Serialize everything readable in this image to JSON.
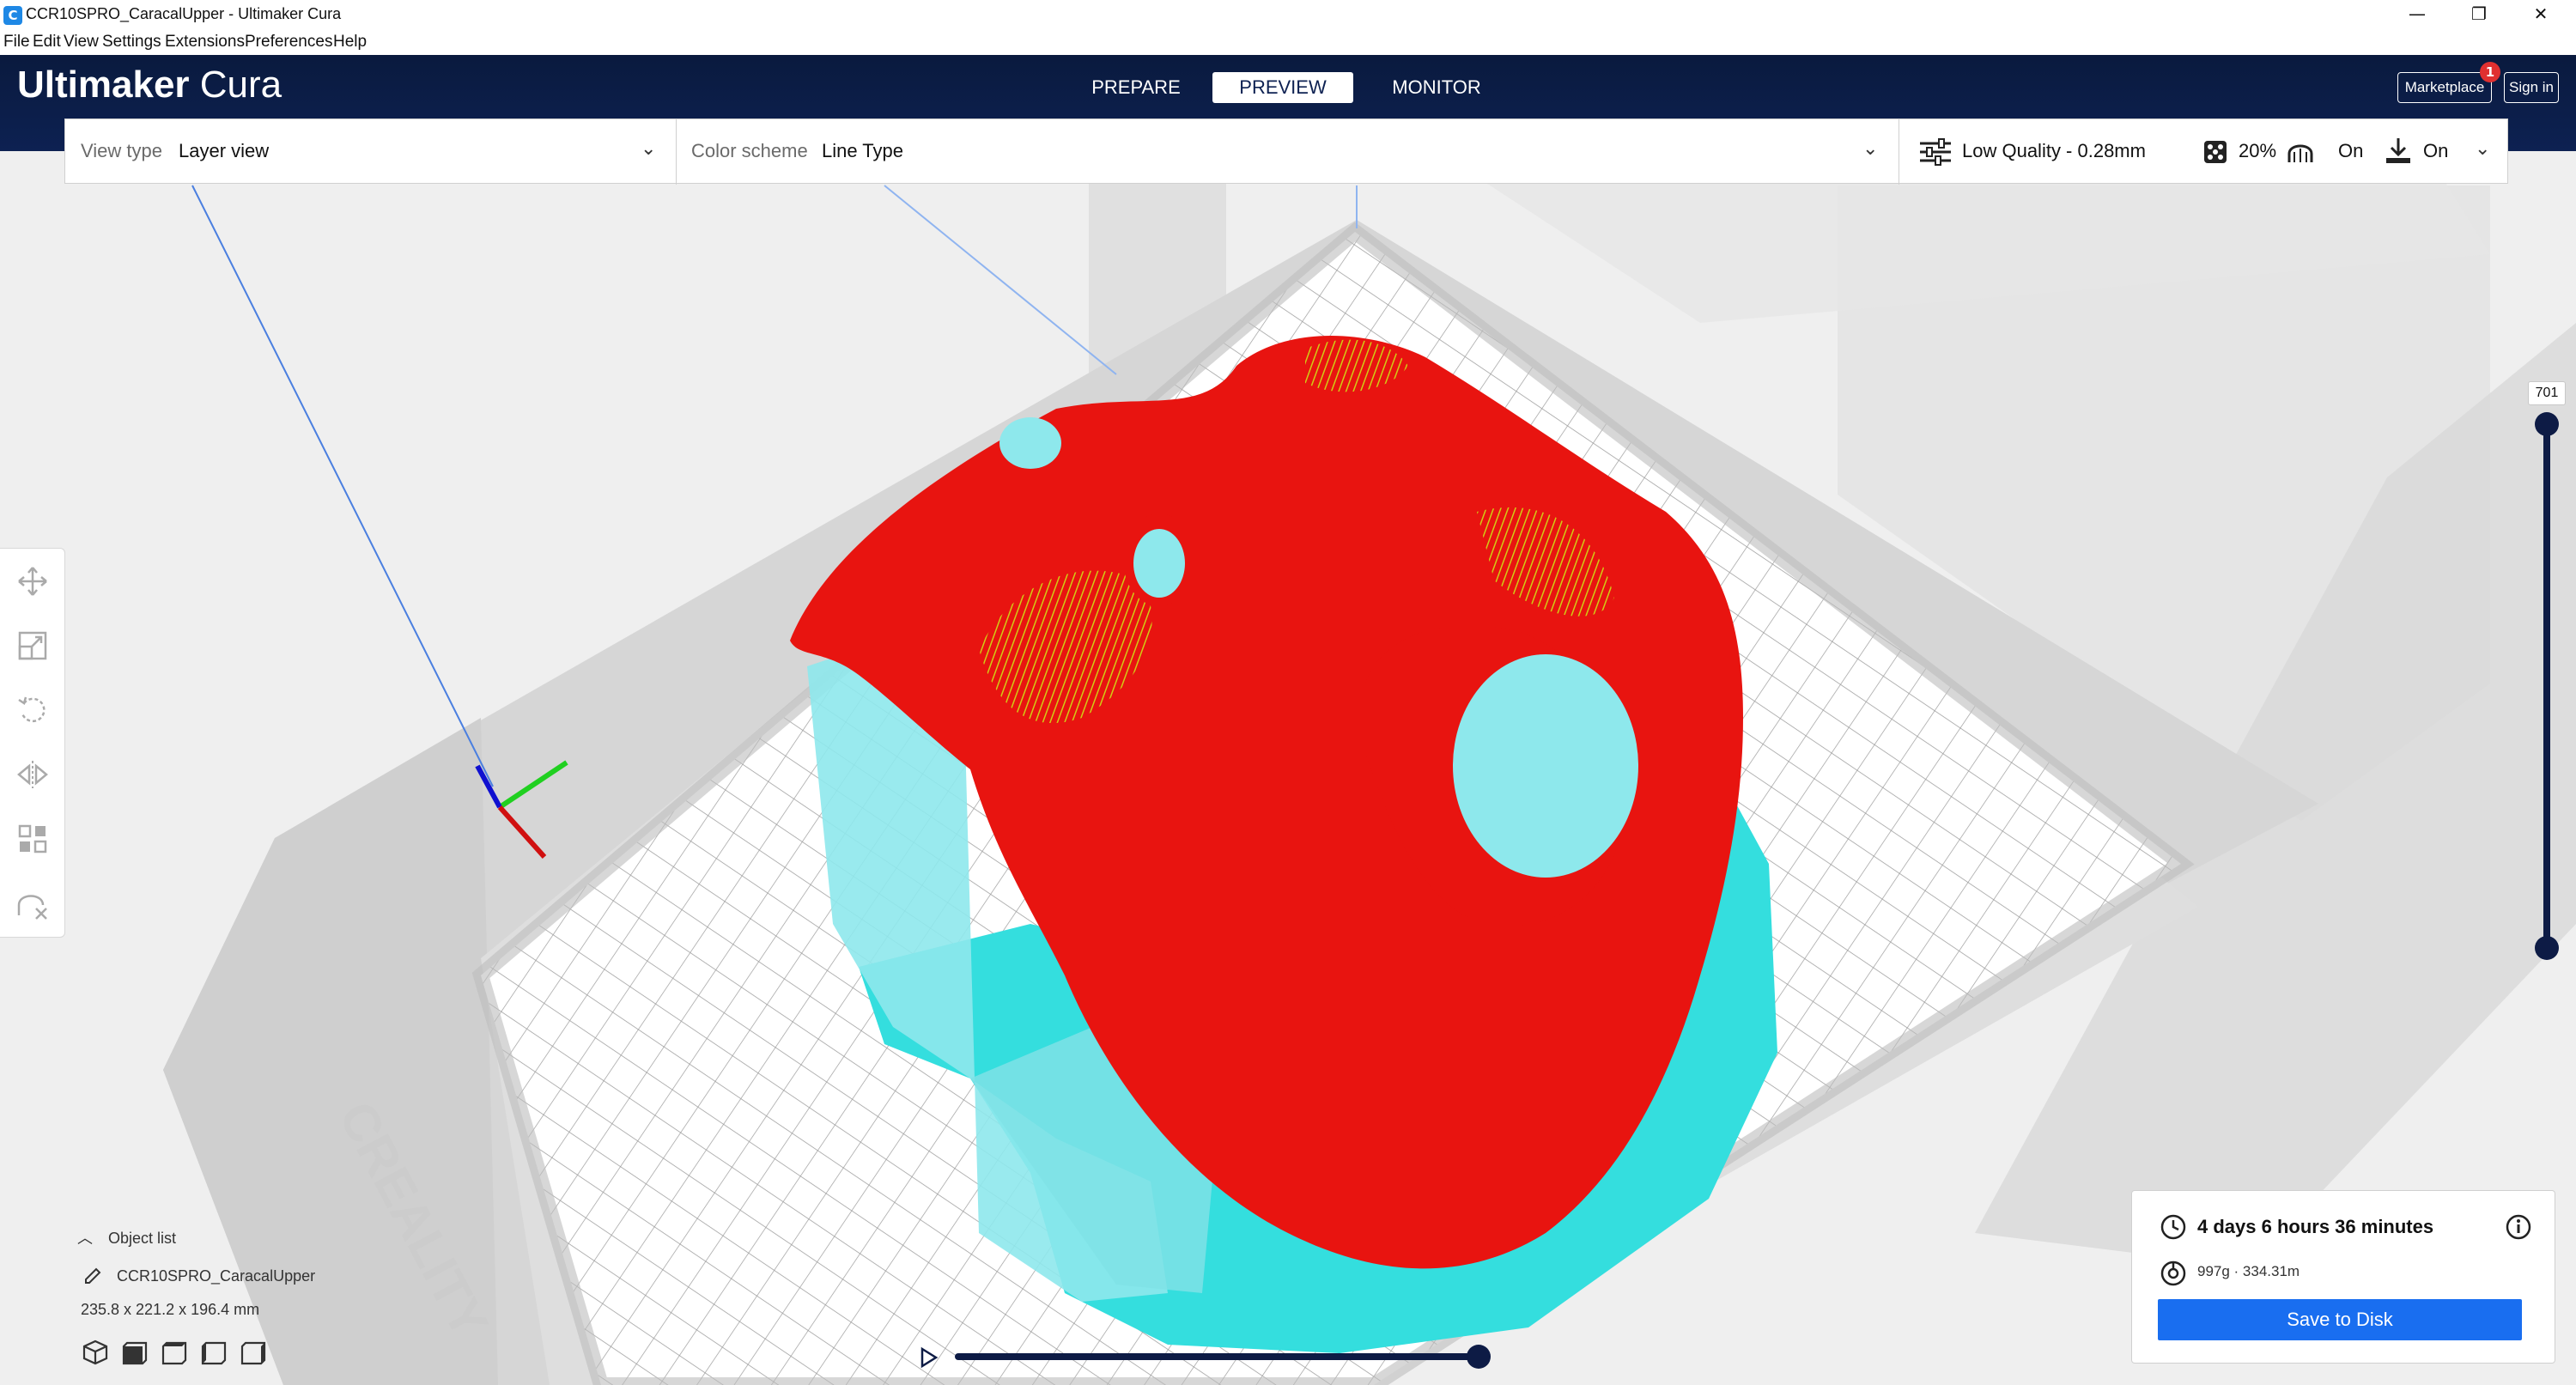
{
  "window": {
    "title": "CCR10SPRO_CaracalUpper - Ultimaker Cura",
    "minimize": "—",
    "maximize": "❐",
    "close": "✕"
  },
  "menu": {
    "items": [
      "File",
      "Edit",
      "View",
      "Settings",
      "Extensions",
      "Preferences",
      "Help"
    ]
  },
  "header": {
    "brand_bold": "Ultimaker",
    "brand_light": "Cura",
    "tabs": [
      "PREPARE",
      "PREVIEW",
      "MONITOR"
    ],
    "active_tab": "PREVIEW",
    "marketplace_label": "Marketplace",
    "marketplace_badge": "1",
    "signin_label": "Sign in"
  },
  "toolbar": {
    "view_type_label": "View type",
    "view_type_value": "Layer view",
    "color_scheme_label": "Color scheme",
    "color_scheme_value": "Line Type",
    "profile": "Low Quality - 0.28mm",
    "infill": "20%",
    "support": "On",
    "adhesion": "On"
  },
  "tools": [
    "move-icon",
    "scale-icon",
    "rotate-icon",
    "mirror-icon",
    "per-model-settings-icon",
    "support-blocker-icon"
  ],
  "layer_slider": {
    "current_layer": "701"
  },
  "object_list": {
    "toggle_label": "Object list",
    "object_name": "CCR10SPRO_CaracalUpper",
    "dimensions": "235.8 x 221.2 x 196.4 mm"
  },
  "camera_views": [
    "3d-view-icon",
    "front-view-icon",
    "top-view-icon",
    "left-view-icon",
    "right-view-icon"
  ],
  "print": {
    "time": "4 days 6 hours 36 minutes",
    "material": "997g · 334.31m",
    "save_label": "Save to Disk"
  },
  "colors": {
    "header_bg": "#0d2152",
    "accent": "#196ef0",
    "wall_red": "#e81410",
    "support_cyan": "#5fe6ea",
    "skin_yellow": "#d9d318"
  }
}
